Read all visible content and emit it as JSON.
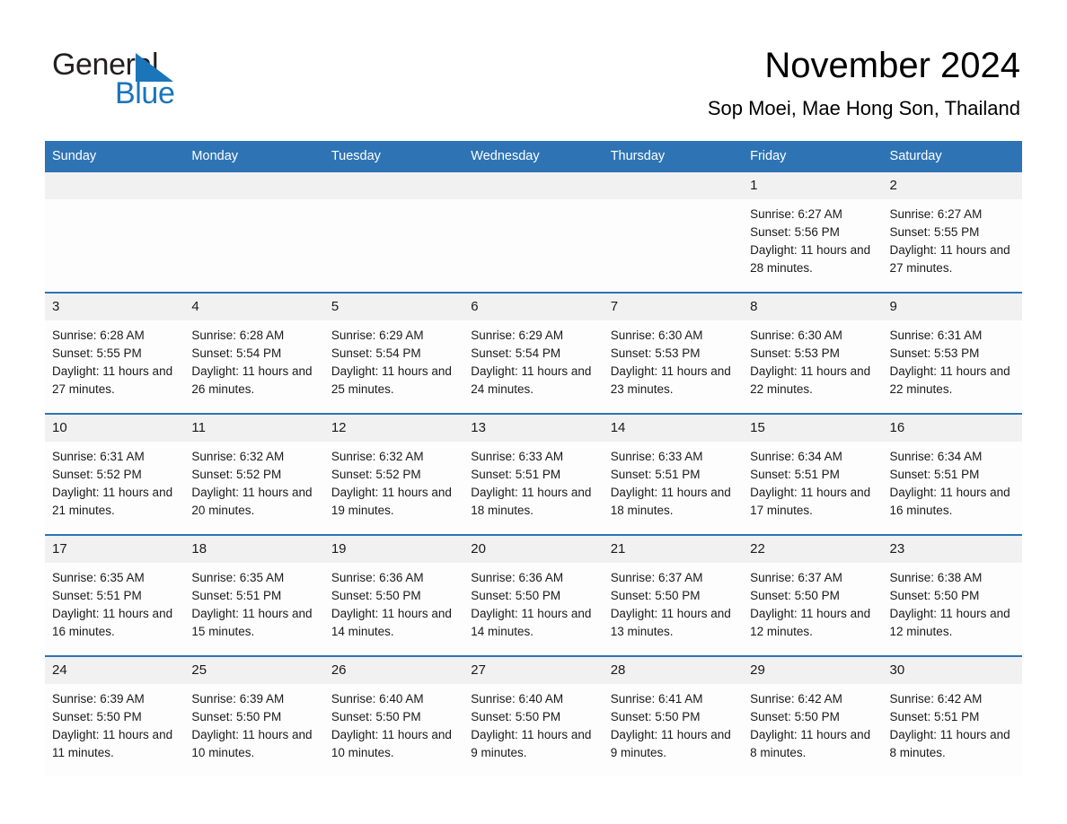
{
  "brand": {
    "name_part1": "General",
    "name_part2": "Blue",
    "triangle_color": "#1b75bb",
    "text_color": "#231f20"
  },
  "header": {
    "title": "November 2024",
    "subtitle": "Sop Moei, Mae Hong Son, Thailand"
  },
  "theme": {
    "header_blue": "#2e74b5",
    "daynum_band": "#f1f1f1",
    "cell_background": "#fdfdfd",
    "page_background": "#ffffff"
  },
  "calendar": {
    "weekday_headers": [
      "Sunday",
      "Monday",
      "Tuesday",
      "Wednesday",
      "Thursday",
      "Friday",
      "Saturday"
    ],
    "labels": {
      "sunrise": "Sunrise:",
      "sunset": "Sunset:",
      "daylight": "Daylight:"
    },
    "weeks": [
      [
        {
          "day": "",
          "empty": true
        },
        {
          "day": "",
          "empty": true
        },
        {
          "day": "",
          "empty": true
        },
        {
          "day": "",
          "empty": true
        },
        {
          "day": "",
          "empty": true
        },
        {
          "day": "1",
          "sunrise": "Sunrise: 6:27 AM",
          "sunset": "Sunset: 5:56 PM",
          "daylight": "Daylight: 11 hours and 28 minutes."
        },
        {
          "day": "2",
          "sunrise": "Sunrise: 6:27 AM",
          "sunset": "Sunset: 5:55 PM",
          "daylight": "Daylight: 11 hours and 27 minutes."
        }
      ],
      [
        {
          "day": "3",
          "sunrise": "Sunrise: 6:28 AM",
          "sunset": "Sunset: 5:55 PM",
          "daylight": "Daylight: 11 hours and 27 minutes."
        },
        {
          "day": "4",
          "sunrise": "Sunrise: 6:28 AM",
          "sunset": "Sunset: 5:54 PM",
          "daylight": "Daylight: 11 hours and 26 minutes."
        },
        {
          "day": "5",
          "sunrise": "Sunrise: 6:29 AM",
          "sunset": "Sunset: 5:54 PM",
          "daylight": "Daylight: 11 hours and 25 minutes."
        },
        {
          "day": "6",
          "sunrise": "Sunrise: 6:29 AM",
          "sunset": "Sunset: 5:54 PM",
          "daylight": "Daylight: 11 hours and 24 minutes."
        },
        {
          "day": "7",
          "sunrise": "Sunrise: 6:30 AM",
          "sunset": "Sunset: 5:53 PM",
          "daylight": "Daylight: 11 hours and 23 minutes."
        },
        {
          "day": "8",
          "sunrise": "Sunrise: 6:30 AM",
          "sunset": "Sunset: 5:53 PM",
          "daylight": "Daylight: 11 hours and 22 minutes."
        },
        {
          "day": "9",
          "sunrise": "Sunrise: 6:31 AM",
          "sunset": "Sunset: 5:53 PM",
          "daylight": "Daylight: 11 hours and 22 minutes."
        }
      ],
      [
        {
          "day": "10",
          "sunrise": "Sunrise: 6:31 AM",
          "sunset": "Sunset: 5:52 PM",
          "daylight": "Daylight: 11 hours and 21 minutes."
        },
        {
          "day": "11",
          "sunrise": "Sunrise: 6:32 AM",
          "sunset": "Sunset: 5:52 PM",
          "daylight": "Daylight: 11 hours and 20 minutes."
        },
        {
          "day": "12",
          "sunrise": "Sunrise: 6:32 AM",
          "sunset": "Sunset: 5:52 PM",
          "daylight": "Daylight: 11 hours and 19 minutes."
        },
        {
          "day": "13",
          "sunrise": "Sunrise: 6:33 AM",
          "sunset": "Sunset: 5:51 PM",
          "daylight": "Daylight: 11 hours and 18 minutes."
        },
        {
          "day": "14",
          "sunrise": "Sunrise: 6:33 AM",
          "sunset": "Sunset: 5:51 PM",
          "daylight": "Daylight: 11 hours and 18 minutes."
        },
        {
          "day": "15",
          "sunrise": "Sunrise: 6:34 AM",
          "sunset": "Sunset: 5:51 PM",
          "daylight": "Daylight: 11 hours and 17 minutes."
        },
        {
          "day": "16",
          "sunrise": "Sunrise: 6:34 AM",
          "sunset": "Sunset: 5:51 PM",
          "daylight": "Daylight: 11 hours and 16 minutes."
        }
      ],
      [
        {
          "day": "17",
          "sunrise": "Sunrise: 6:35 AM",
          "sunset": "Sunset: 5:51 PM",
          "daylight": "Daylight: 11 hours and 16 minutes."
        },
        {
          "day": "18",
          "sunrise": "Sunrise: 6:35 AM",
          "sunset": "Sunset: 5:51 PM",
          "daylight": "Daylight: 11 hours and 15 minutes."
        },
        {
          "day": "19",
          "sunrise": "Sunrise: 6:36 AM",
          "sunset": "Sunset: 5:50 PM",
          "daylight": "Daylight: 11 hours and 14 minutes."
        },
        {
          "day": "20",
          "sunrise": "Sunrise: 6:36 AM",
          "sunset": "Sunset: 5:50 PM",
          "daylight": "Daylight: 11 hours and 14 minutes."
        },
        {
          "day": "21",
          "sunrise": "Sunrise: 6:37 AM",
          "sunset": "Sunset: 5:50 PM",
          "daylight": "Daylight: 11 hours and 13 minutes."
        },
        {
          "day": "22",
          "sunrise": "Sunrise: 6:37 AM",
          "sunset": "Sunset: 5:50 PM",
          "daylight": "Daylight: 11 hours and 12 minutes."
        },
        {
          "day": "23",
          "sunrise": "Sunrise: 6:38 AM",
          "sunset": "Sunset: 5:50 PM",
          "daylight": "Daylight: 11 hours and 12 minutes."
        }
      ],
      [
        {
          "day": "24",
          "sunrise": "Sunrise: 6:39 AM",
          "sunset": "Sunset: 5:50 PM",
          "daylight": "Daylight: 11 hours and 11 minutes."
        },
        {
          "day": "25",
          "sunrise": "Sunrise: 6:39 AM",
          "sunset": "Sunset: 5:50 PM",
          "daylight": "Daylight: 11 hours and 10 minutes."
        },
        {
          "day": "26",
          "sunrise": "Sunrise: 6:40 AM",
          "sunset": "Sunset: 5:50 PM",
          "daylight": "Daylight: 11 hours and 10 minutes."
        },
        {
          "day": "27",
          "sunrise": "Sunrise: 6:40 AM",
          "sunset": "Sunset: 5:50 PM",
          "daylight": "Daylight: 11 hours and 9 minutes."
        },
        {
          "day": "28",
          "sunrise": "Sunrise: 6:41 AM",
          "sunset": "Sunset: 5:50 PM",
          "daylight": "Daylight: 11 hours and 9 minutes."
        },
        {
          "day": "29",
          "sunrise": "Sunrise: 6:42 AM",
          "sunset": "Sunset: 5:50 PM",
          "daylight": "Daylight: 11 hours and 8 minutes."
        },
        {
          "day": "30",
          "sunrise": "Sunrise: 6:42 AM",
          "sunset": "Sunset: 5:51 PM",
          "daylight": "Daylight: 11 hours and 8 minutes."
        }
      ]
    ]
  }
}
